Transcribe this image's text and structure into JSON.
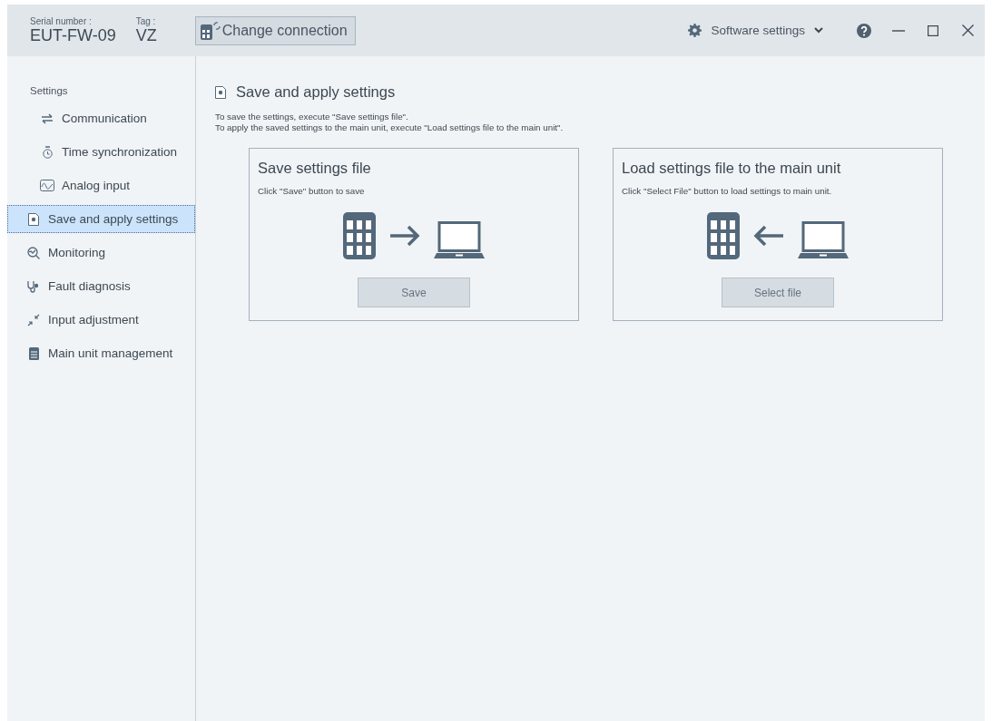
{
  "header": {
    "serial_label": "Serial number :",
    "serial_value": "EUT-FW-09",
    "tag_label": "Tag :",
    "tag_value": "VZ",
    "change_connection": "Change connection",
    "software_settings": "Software settings"
  },
  "sidebar": {
    "items": [
      {
        "kind": "group",
        "label": "Settings",
        "children": [
          {
            "kind": "item",
            "label": "Communication",
            "selected": false
          },
          {
            "kind": "item",
            "label": "Time synchronization",
            "selected": false
          },
          {
            "kind": "item",
            "label": "Analog input",
            "selected": false
          }
        ]
      },
      {
        "kind": "item",
        "label": "Save and apply settings",
        "selected": true
      },
      {
        "kind": "item",
        "label": "Monitoring",
        "selected": false
      },
      {
        "kind": "item",
        "label": "Fault diagnosis",
        "selected": false
      },
      {
        "kind": "item",
        "label": "Input adjustment",
        "selected": false
      },
      {
        "kind": "item",
        "label": "Main unit management",
        "selected": false
      }
    ]
  },
  "page": {
    "title": "Save and apply settings",
    "description": [
      "To save the settings, execute \"Save settings file\".",
      "To apply the saved settings to the main unit, execute \"Load settings file to the main unit\"."
    ],
    "cards": [
      {
        "kind": "save",
        "title": "Save settings file",
        "text": "Click \"Save\" button to save",
        "button": "Save",
        "disabled": true
      },
      {
        "kind": "load",
        "title": "Load settings file to the main unit",
        "text": "Click \"Select File\" button to load settings to main unit.",
        "button": "Select file",
        "disabled": true
      }
    ]
  }
}
